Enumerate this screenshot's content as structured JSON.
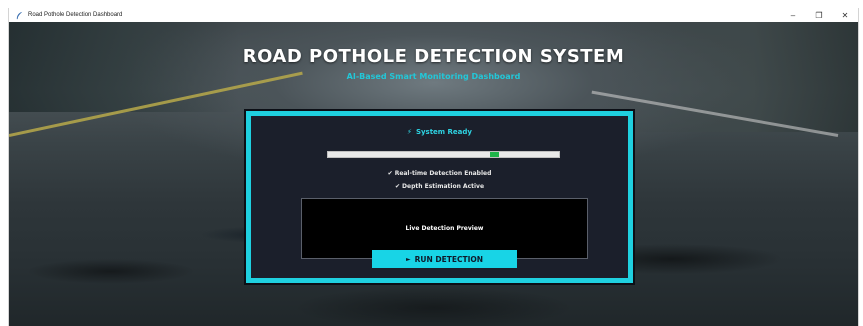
{
  "window": {
    "title": "Road Pothole Detection Dashboard",
    "controls": {
      "minimize": "–",
      "maximize": "❐",
      "close": "✕"
    }
  },
  "header": {
    "title": "ROAD POTHOLE DETECTION SYSTEM",
    "subtitle": "AI-Based Smart Monitoring Dashboard"
  },
  "panel": {
    "status_icon": "⚡",
    "status_text": "System Ready",
    "progress_marker_position": 0.72,
    "checks": [
      "✔ Real-time Detection Enabled",
      "✔ Depth Estimation Active"
    ],
    "preview_label": "Live Detection Preview",
    "run_button": {
      "icon": "►",
      "label": "RUN DETECTION"
    }
  },
  "colors": {
    "accent": "#1fd0e0",
    "panel_bg": "#1b1f2b",
    "progress_fill": "#1fb34a",
    "button_text": "#0d1a2a"
  }
}
